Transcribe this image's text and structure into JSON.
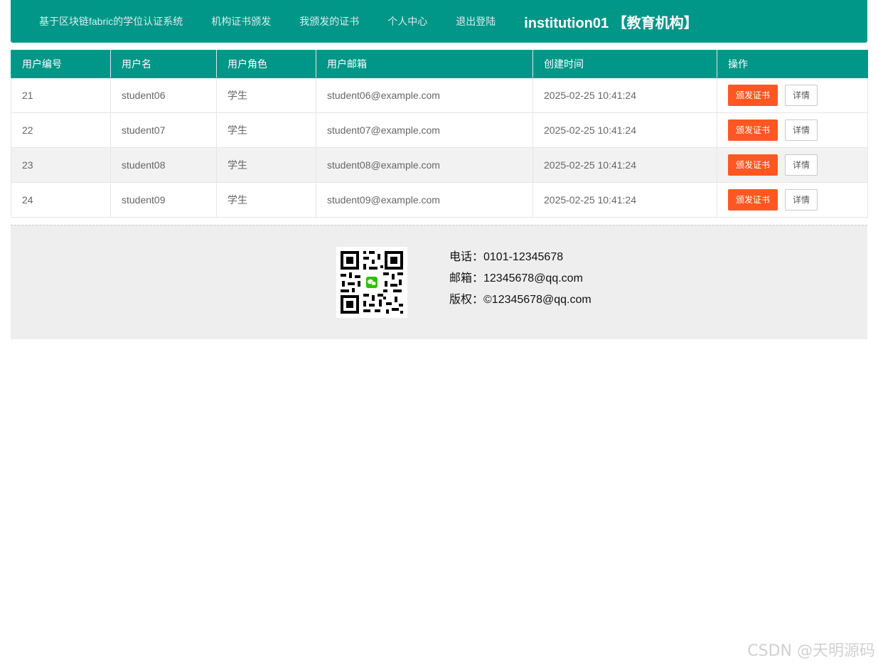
{
  "nav": {
    "brand": "基于区块链fabric的学位认证系统",
    "links": [
      "机构证书颁发",
      "我颁发的证书",
      "个人中心",
      "退出登陆"
    ],
    "user_label": "institution01 【教育机构】"
  },
  "table": {
    "columns": [
      "用户编号",
      "用户名",
      "用户角色",
      "用户邮箱",
      "创建时间",
      "操作"
    ],
    "rows": [
      {
        "id": "21",
        "username": "student06",
        "role": "学生",
        "email": "student06@example.com",
        "created": "2025-02-25 10:41:24"
      },
      {
        "id": "22",
        "username": "student07",
        "role": "学生",
        "email": "student07@example.com",
        "created": "2025-02-25 10:41:24"
      },
      {
        "id": "23",
        "username": "student08",
        "role": "学生",
        "email": "student08@example.com",
        "created": "2025-02-25 10:41:24"
      },
      {
        "id": "24",
        "username": "student09",
        "role": "学生",
        "email": "student09@example.com",
        "created": "2025-02-25 10:41:24"
      }
    ],
    "actions": {
      "issue_label": "颁发证书",
      "detail_label": "详情"
    }
  },
  "footer": {
    "phone": "电话：0101-12345678",
    "email": "邮箱：12345678@qq.com",
    "copyright": "版权：©12345678@qq.com"
  },
  "watermark": "CSDN @天明源码",
  "colors": {
    "primary": "#009688",
    "danger": "#ff5722",
    "footer_bg": "#eeeeee",
    "row_alt": "#f2f2f2"
  },
  "icons": {
    "qr": "wechat-qr-code-icon"
  }
}
